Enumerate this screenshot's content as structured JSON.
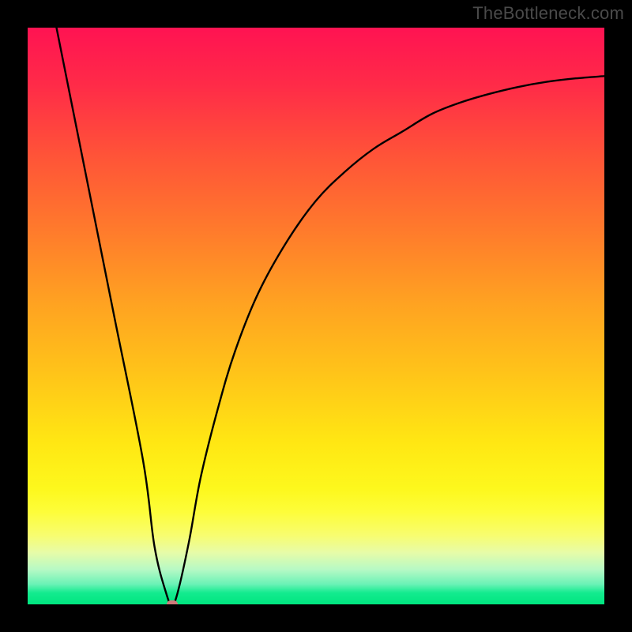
{
  "watermark": "TheBottleneck.com",
  "chart_data": {
    "type": "line",
    "title": "",
    "xlabel": "",
    "ylabel": "",
    "xlim": [
      0,
      100
    ],
    "ylim": [
      0,
      100
    ],
    "grid": false,
    "legend": false,
    "series": [
      {
        "name": "bottleneck-curve",
        "x": [
          5,
          10,
          15,
          20,
          22,
          24,
          25,
          26,
          28,
          30,
          33,
          36,
          40,
          45,
          50,
          55,
          60,
          65,
          70,
          75,
          80,
          85,
          90,
          95,
          100
        ],
        "values": [
          100,
          75,
          50,
          25,
          10,
          2,
          0,
          2,
          11,
          22,
          34,
          44,
          54,
          63,
          70,
          75,
          79,
          82,
          85,
          87,
          88.5,
          89.7,
          90.6,
          91.2,
          91.6
        ]
      }
    ],
    "marker": {
      "x": 25,
      "y": 0,
      "color": "#cf7b7b"
    }
  }
}
